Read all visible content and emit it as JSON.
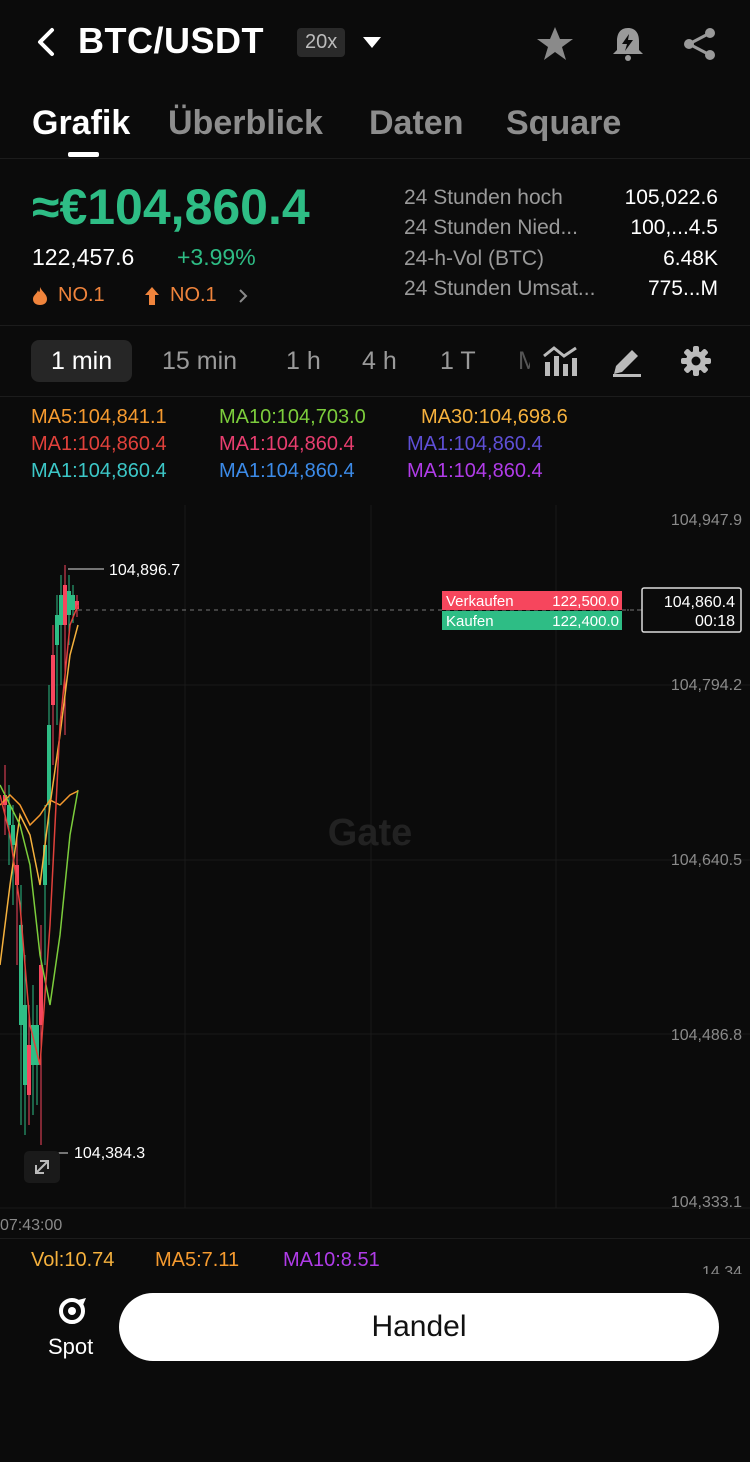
{
  "header": {
    "pair": "BTC/USDT",
    "leverage": "20x"
  },
  "tabs": [
    {
      "label": "Grafik"
    },
    {
      "label": "Überblick"
    },
    {
      "label": "Daten"
    },
    {
      "label": "Square"
    }
  ],
  "ticker": {
    "price": "≈€104,860.4",
    "last": "122,457.6",
    "change": "+3.99%",
    "rank1": "NO.1",
    "rank2": "NO.1"
  },
  "stats": [
    {
      "label": "24 Stunden hoch",
      "value": "105,022.6"
    },
    {
      "label": "24 Stunden Nied...",
      "value": "100,...4.5"
    },
    {
      "label": "24-h-Vol (BTC)",
      "value": "6.48K"
    },
    {
      "label": "24 Stunden Umsat...",
      "value": "775...M"
    }
  ],
  "timeframes": [
    {
      "label": "1 min"
    },
    {
      "label": "15 min"
    },
    {
      "label": "1 h"
    },
    {
      "label": "4 h"
    },
    {
      "label": "1 T"
    },
    {
      "label": "M"
    }
  ],
  "ma_rows": [
    [
      {
        "text": "MA5:104,841.1",
        "color": "#f59a2f"
      },
      {
        "text": "MA10:104,703.0",
        "color": "#7ccd3c"
      },
      {
        "text": "MA30:104,698.6",
        "color": "#f5b13d"
      }
    ],
    [
      {
        "text": "MA1:104,860.4",
        "color": "#e0413b"
      },
      {
        "text": "MA1:104,860.4",
        "color": "#e83e6f"
      },
      {
        "text": "MA1:104,860.4",
        "color": "#5e4fd6"
      }
    ],
    [
      {
        "text": "MA1:104,860.4",
        "color": "#3cc7c7"
      },
      {
        "text": "MA1:104,860.4",
        "color": "#3c8be8"
      },
      {
        "text": "MA1:104,860.4",
        "color": "#b03ce8"
      }
    ]
  ],
  "chart": {
    "y_ticks": [
      "104,947.9",
      "104,794.2",
      "104,640.5",
      "104,486.8",
      "104,333.1"
    ],
    "x_tick": "07:43:00",
    "high_label": "104,896.7",
    "low_label": "104,384.3",
    "sell_label": "Verkaufen",
    "sell_value": "122,500.0",
    "buy_label": "Kaufen",
    "buy_value": "122,400.0",
    "current_price": "104,860.4",
    "countdown": "00:18",
    "watermark": "Gate"
  },
  "volume": {
    "vol": "Vol:10.74",
    "ma5": "MA5:7.11",
    "ma10": "MA10:8.51",
    "axis": "14.34"
  },
  "footer": {
    "spot": "Spot",
    "trade": "Handel"
  },
  "colors": {
    "up": "#2ebd85",
    "down": "#f6465d",
    "accent_orange": "#f0843c"
  }
}
